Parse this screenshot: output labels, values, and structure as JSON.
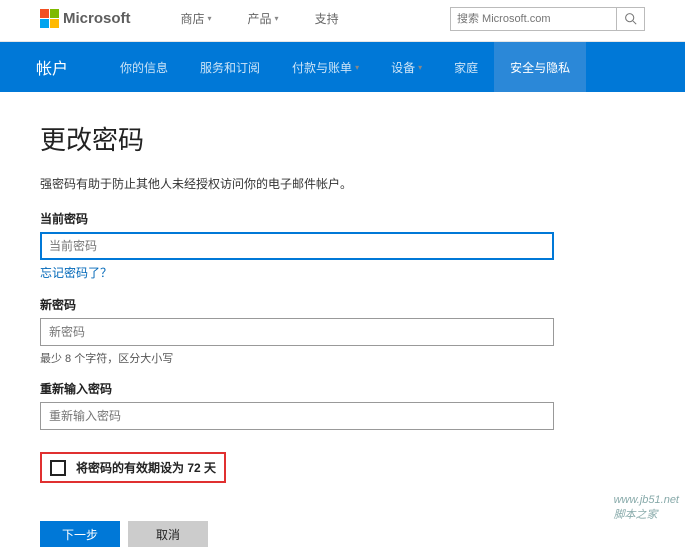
{
  "topbar": {
    "brand": "Microsoft",
    "menu": [
      {
        "label": "商店",
        "has_chev": true
      },
      {
        "label": "产品",
        "has_chev": true
      },
      {
        "label": "支持",
        "has_chev": false
      }
    ],
    "search_placeholder": "搜索 Microsoft.com"
  },
  "navbar": {
    "title": "帐户",
    "items": [
      {
        "label": "你的信息",
        "active": false,
        "has_chev": false
      },
      {
        "label": "服务和订阅",
        "active": false,
        "has_chev": false
      },
      {
        "label": "付款与账单",
        "active": false,
        "has_chev": true
      },
      {
        "label": "设备",
        "active": false,
        "has_chev": true
      },
      {
        "label": "家庭",
        "active": false,
        "has_chev": false
      },
      {
        "label": "安全与隐私",
        "active": true,
        "has_chev": false
      }
    ]
  },
  "page": {
    "heading": "更改密码",
    "description": "强密码有助于防止其他人未经授权访问你的电子邮件帐户。",
    "current_pw_label": "当前密码",
    "current_pw_placeholder": "当前密码",
    "forgot_link": "忘记密码了？",
    "new_pw_label": "新密码",
    "new_pw_placeholder": "新密码",
    "pw_hint": "最少 8 个字符，区分大小写",
    "confirm_pw_label": "重新输入密码",
    "confirm_pw_placeholder": "重新输入密码",
    "expiry_checkbox_label": "将密码的有效期设为 72 天",
    "expiry_checked": false,
    "btn_next": "下一步",
    "btn_cancel": "取消"
  },
  "watermark": {
    "site": "www.jb51.net",
    "name": "脚本之家"
  }
}
